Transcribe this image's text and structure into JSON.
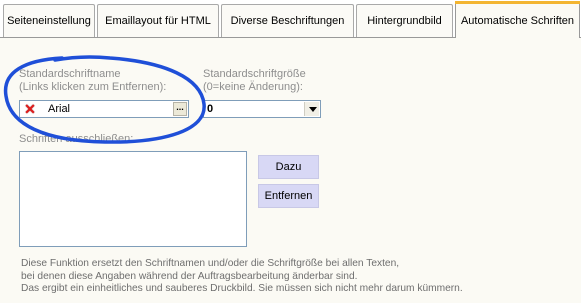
{
  "tabs": [
    {
      "label": "Seiteneinstellung"
    },
    {
      "label": "Emaillayout für HTML"
    },
    {
      "label": "Diverse Beschriftungen"
    },
    {
      "label": "Hintergrundbild"
    },
    {
      "label": "Automatische Schriften"
    }
  ],
  "active_tab": "Automatische Schriften",
  "font_name": {
    "label_line1": "Standardschriftname",
    "label_line2": "(Links klicken zum Entfernen):",
    "value": "Arial",
    "browse_label": "..."
  },
  "font_size": {
    "label_line1": "Standardschriftgröße",
    "label_line2": "(0=keine Änderung):",
    "value": "0"
  },
  "exclude_fonts": {
    "label": "Schriften ausschließen:",
    "items": []
  },
  "buttons": {
    "add": "Dazu",
    "remove": "Entfernen"
  },
  "info_lines": [
    "Diese Funktion ersetzt den Schriftnamen und/oder die Schriftgröße bei allen Texten,",
    "bei denen diese Angaben  während der Auftragsbearbeitung änderbar sind.",
    "Das ergibt ein einheitliches und sauberes Druckbild. Sie müssen sich nicht mehr darum kümmern."
  ],
  "colors": {
    "accent_tab_highlight": "#f3b531",
    "button_bg": "#d8d8f5",
    "annotation": "#1f4fd8",
    "remove_icon": "#e01b1b"
  }
}
